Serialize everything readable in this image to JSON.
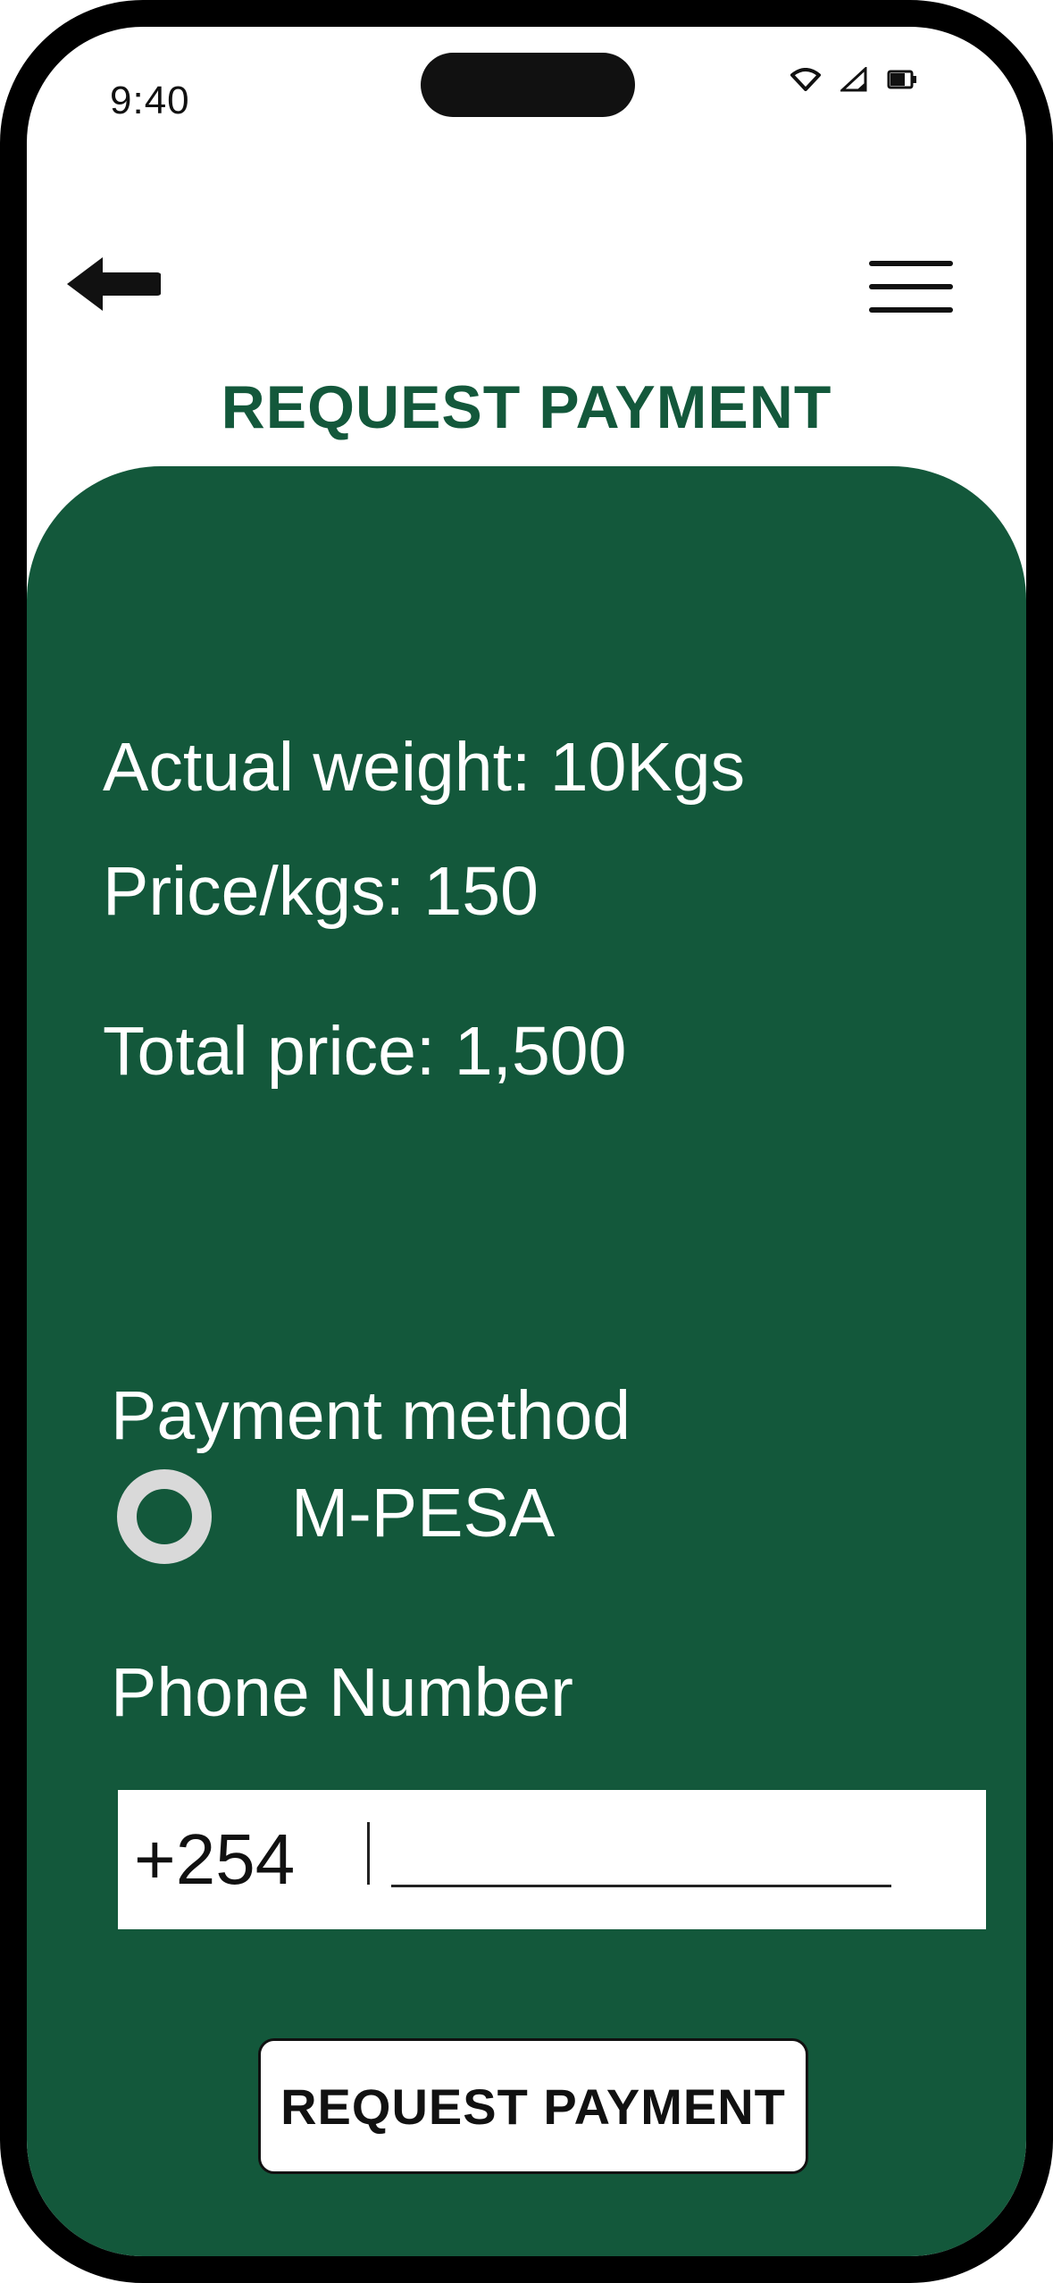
{
  "status_bar": {
    "time": "9:40",
    "icons": [
      "wifi-icon",
      "cellular-signal-icon",
      "battery-icon"
    ]
  },
  "header": {
    "back_icon": "arrow-left-icon",
    "menu_icon": "hamburger-menu-icon",
    "title": "REQUEST PAYMENT"
  },
  "summary": {
    "actual_weight": "Actual weight: 10Kgs",
    "price_per_kg": "Price/kgs: 150",
    "total_price": "Total price: 1,500"
  },
  "payment": {
    "label": "Payment method",
    "options": [
      {
        "label": "M-PESA",
        "selected": false
      }
    ]
  },
  "phone": {
    "label": "Phone Number",
    "prefix": "+254",
    "value": "",
    "placeholder": ""
  },
  "actions": {
    "submit_label": "REQUEST PAYMENT"
  },
  "colors": {
    "primary_green": "#13583b",
    "radio_ring": "#d9d9d9",
    "frame": "#000000"
  }
}
